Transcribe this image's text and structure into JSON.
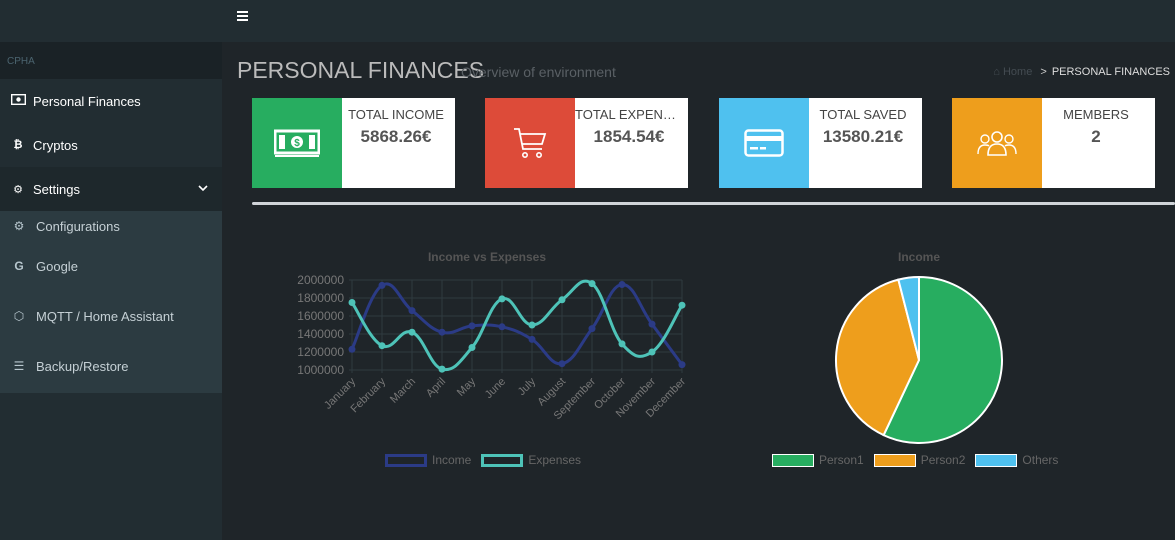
{
  "sidebar": {
    "brand": "CPHA",
    "items": [
      {
        "label": "Personal Finances"
      },
      {
        "label": "Cryptos"
      },
      {
        "label": "Settings"
      }
    ],
    "submenu": [
      {
        "label": "Configurations"
      },
      {
        "label": "Google"
      },
      {
        "label": "MQTT / Home Assistant"
      },
      {
        "label": "Backup/Restore"
      }
    ]
  },
  "header": {
    "title": "PERSONAL FINANCES",
    "subtitle": "Overview of environment",
    "breadcrumb": {
      "home": "Home",
      "current": "PERSONAL FINANCES"
    }
  },
  "cards": [
    {
      "label": "TOTAL INCOME",
      "value": "5868.26€",
      "color": "#27ad60"
    },
    {
      "label": "TOTAL EXPENSES",
      "value": "1854.54€",
      "color": "#dd4b39"
    },
    {
      "label": "TOTAL SAVED",
      "value": "13580.21€",
      "color": "#4fc1ef"
    },
    {
      "label": "MEMBERS",
      "value": "2",
      "color": "#ee9e1c"
    }
  ],
  "chart_data": [
    {
      "type": "line",
      "title": "Income vs Expenses",
      "categories": [
        "January",
        "February",
        "March",
        "April",
        "May",
        "June",
        "July",
        "August",
        "September",
        "October",
        "November",
        "December"
      ],
      "yticks": [
        "2000000",
        "1800000",
        "1600000",
        "1400000",
        "1200000",
        "1000000"
      ],
      "ylim": [
        1000000,
        2000000
      ],
      "series": [
        {
          "name": "Income",
          "color": "#2b3b86",
          "values": [
            1230000,
            1940000,
            1660000,
            1420000,
            1490000,
            1480000,
            1340000,
            1070000,
            1460000,
            1950000,
            1510000,
            1060000
          ]
        },
        {
          "name": "Expenses",
          "color": "#4ec3b8",
          "values": [
            1750000,
            1270000,
            1420000,
            1010000,
            1250000,
            1790000,
            1500000,
            1780000,
            1960000,
            1290000,
            1200000,
            1720000
          ]
        }
      ],
      "legend": "bottom",
      "grid": true
    },
    {
      "type": "pie",
      "title": "Income",
      "series": [
        {
          "name": "Person1",
          "value": 57,
          "color": "#27ad60"
        },
        {
          "name": "Person2",
          "value": 39,
          "color": "#ee9e1c"
        },
        {
          "name": "Others",
          "value": 4,
          "color": "#4fc1ef"
        }
      ],
      "legend": "bottom"
    }
  ]
}
